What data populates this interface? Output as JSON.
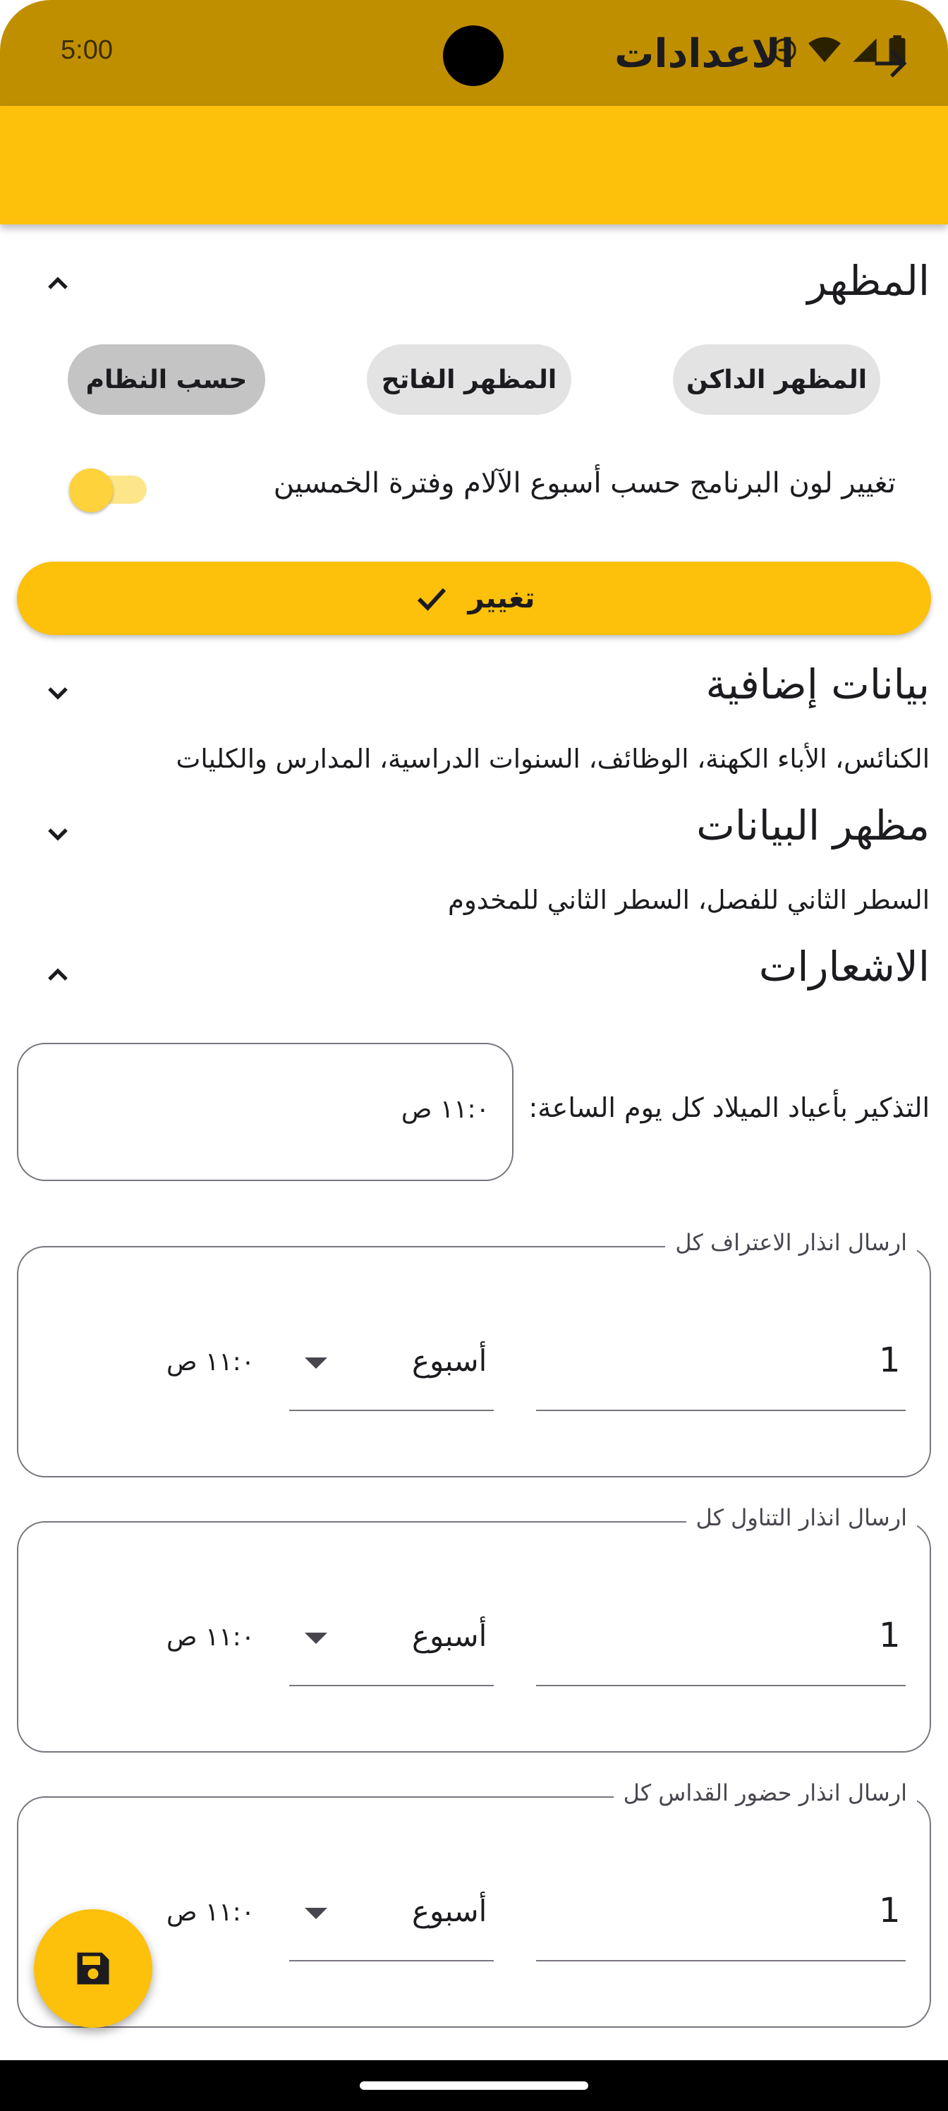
{
  "status": {
    "time": "5:00"
  },
  "appbar": {
    "title": "الاعدادات"
  },
  "appearance": {
    "title": "المظهر",
    "chips": [
      "المظهر الداكن",
      "المظهر الفاتح",
      "حسب النظام"
    ],
    "selected_chip": "حسب النظام",
    "toggle_label": "تغيير لون البرنامج حسب أسبوع الآلام وفترة الخمسين",
    "toggle_on": false,
    "change_button": "تغيير"
  },
  "extra_data": {
    "title": "بيانات إضافية",
    "subtitle": "الكنائس، الأباء الكهنة، الوظائف، السنوات الدراسية، المدارس والكليات"
  },
  "data_view": {
    "title": "مظهر البيانات",
    "subtitle": "السطر الثاني للفصل، السطر الثاني للمخدوم"
  },
  "notifications": {
    "title": "الاشعارات",
    "birthday_label": "التذكير بأعياد الميلاد كل يوم الساعة:",
    "birthday_time": "١١:٠ ص",
    "groups": [
      {
        "legend": "ارسال انذار الاعتراف كل",
        "count": "1",
        "period": "أسبوع",
        "time": "١١:٠ ص"
      },
      {
        "legend": "ارسال انذار التناول كل",
        "count": "1",
        "period": "أسبوع",
        "time": "١١:٠ ص"
      },
      {
        "legend": "ارسال انذار حضور القداس كل",
        "count": "1",
        "period": "أسبوع",
        "time": "١١:٠ ص"
      }
    ]
  },
  "colors": {
    "accent": "#fdc00b",
    "statusbar": "#c08f00"
  },
  "icons": {
    "back": "arrow-right-icon",
    "save": "floppy-disk-icon",
    "check": "check-icon"
  }
}
